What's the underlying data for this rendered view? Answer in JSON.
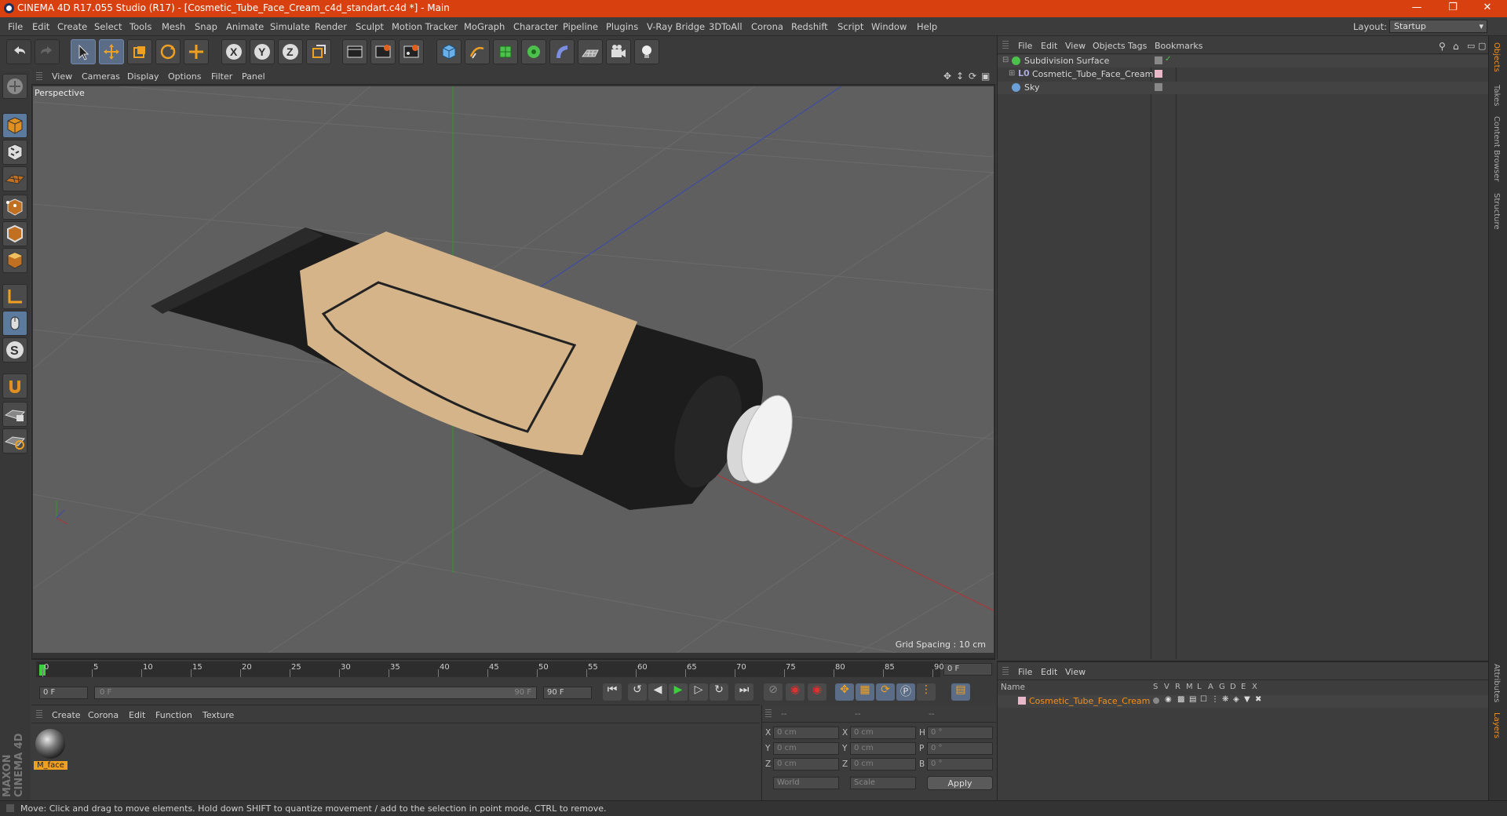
{
  "title_bar": {
    "title": "CINEMA 4D R17.055 Studio (R17) - [Cosmetic_Tube_Face_Cream_c4d_standart.c4d *] - Main"
  },
  "menu": [
    "File",
    "Edit",
    "Create",
    "Select",
    "Tools",
    "Mesh",
    "Snap",
    "Animate",
    "Simulate",
    "Render",
    "Sculpt",
    "Motion Tracker",
    "MoGraph",
    "Character",
    "Pipeline",
    "Plugins",
    "V-Ray Bridge",
    "3DToAll",
    "Corona",
    "Redshift",
    "Script",
    "Window",
    "Help"
  ],
  "layout": {
    "label": "Layout:",
    "value": "Startup"
  },
  "viewport": {
    "menu": [
      "View",
      "Cameras",
      "Display",
      "Options",
      "Filter",
      "Panel"
    ],
    "camera_label": "Perspective",
    "grid_spacing": "Grid Spacing : 10 cm"
  },
  "object_manager": {
    "menu": [
      "File",
      "Edit",
      "View",
      "Objects",
      "Tags",
      "Bookmarks"
    ],
    "objects": [
      "Subdivision Surface",
      "Cosmetic_Tube_Face_Cream",
      "Sky"
    ]
  },
  "layer_manager": {
    "menu": [
      "File",
      "Edit",
      "View"
    ],
    "header": {
      "name": "Name",
      "cols": [
        "S",
        "V",
        "R",
        "M",
        "L",
        "A",
        "G",
        "D",
        "E",
        "X"
      ]
    },
    "layers": [
      "Cosmetic_Tube_Face_Cream"
    ]
  },
  "timeline": {
    "ticks": [
      "0",
      "5",
      "10",
      "15",
      "20",
      "25",
      "30",
      "35",
      "40",
      "45",
      "50",
      "55",
      "60",
      "65",
      "70",
      "75",
      "80",
      "85",
      "90"
    ],
    "frame_end_box": "0 F",
    "start_field": "0 F",
    "slider_left": "0 F",
    "slider_right": "90 F",
    "end_field": "90 F"
  },
  "material_manager": {
    "menu": [
      "Create",
      "Corona",
      "Edit",
      "Function",
      "Texture"
    ],
    "materials": [
      "M_face"
    ]
  },
  "coordinates": {
    "headers": [
      "--",
      "--",
      "--"
    ],
    "rows": [
      {
        "a": "X",
        "v1": "0 cm",
        "b": "X",
        "v2": "0 cm",
        "c": "H",
        "v3": "0 °"
      },
      {
        "a": "Y",
        "v1": "0 cm",
        "b": "Y",
        "v2": "0 cm",
        "c": "P",
        "v3": "0 °"
      },
      {
        "a": "Z",
        "v1": "0 cm",
        "b": "Z",
        "v2": "0 cm",
        "c": "B",
        "v3": "0 °"
      }
    ],
    "mode1": "World",
    "mode2": "Scale",
    "apply": "Apply"
  },
  "right_tabs": [
    "Objects",
    "Takes",
    "Content Browser",
    "Structure",
    "Attributes",
    "Layers"
  ],
  "status": "Move: Click and drag to move elements. Hold down SHIFT to quantize movement / add to the selection in point mode, CTRL to remove.",
  "branding": [
    "MAXON",
    "CINEMA 4D"
  ],
  "colors": {
    "titlebar": "#d8410f",
    "accent": "#f09020",
    "viewport_bg": "#5f5f5f"
  }
}
